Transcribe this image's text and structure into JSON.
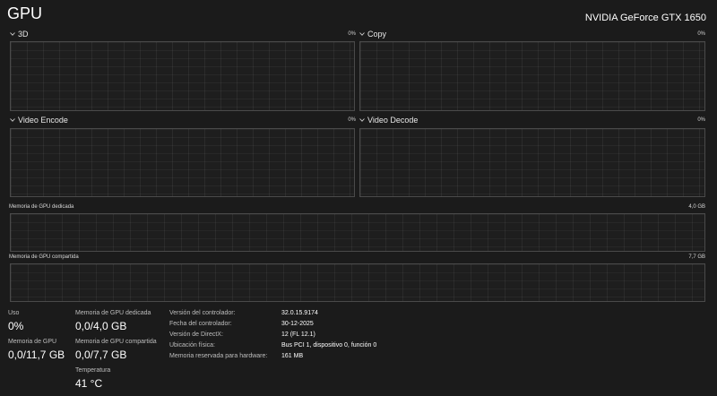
{
  "header": {
    "title": "GPU",
    "gpu_name": "NVIDIA GeForce GTX 1650"
  },
  "graphs": [
    {
      "label": "3D",
      "percent": "0%"
    },
    {
      "label": "Copy",
      "percent": "0%"
    },
    {
      "label": "Video Encode",
      "percent": "0%"
    },
    {
      "label": "Video Decode",
      "percent": "0%"
    }
  ],
  "memory_graphs": {
    "dedicated": {
      "label": "Memoria de GPU dedicada",
      "max": "4,0 GB"
    },
    "shared": {
      "label": "Memoria de GPU compartida",
      "max": "7,7 GB"
    }
  },
  "stats": {
    "usage": {
      "label": "Uso",
      "value": "0%"
    },
    "gpu_memory": {
      "label": "Memoria de GPU",
      "value": "0,0/11,7 GB"
    },
    "dedicated_memory": {
      "label": "Memoria de GPU dedicada",
      "value": "0,0/4,0 GB"
    },
    "shared_memory": {
      "label": "Memoria de GPU compartida",
      "value": "0,0/7,7 GB"
    },
    "temperature": {
      "label": "Temperatura",
      "value": "41 °C"
    }
  },
  "details": [
    {
      "key": "Versión del controlador:",
      "value": "32.0.15.9174"
    },
    {
      "key": "Fecha del controlador:",
      "value": "30-12-2025"
    },
    {
      "key": "Versión de DirectX:",
      "value": "12 (FL 12.1)"
    },
    {
      "key": "Ubicación física:",
      "value": "Bus PCI 1, dispositivo 0, función 0"
    },
    {
      "key": "Memoria reservada para hardware:",
      "value": "161 MB"
    }
  ],
  "icons": {
    "graph_header": "chevron-down-icon"
  },
  "colors": {
    "background": "#1b1b1b",
    "graph_border": "#4a4a4a",
    "text": "#ffffff"
  }
}
